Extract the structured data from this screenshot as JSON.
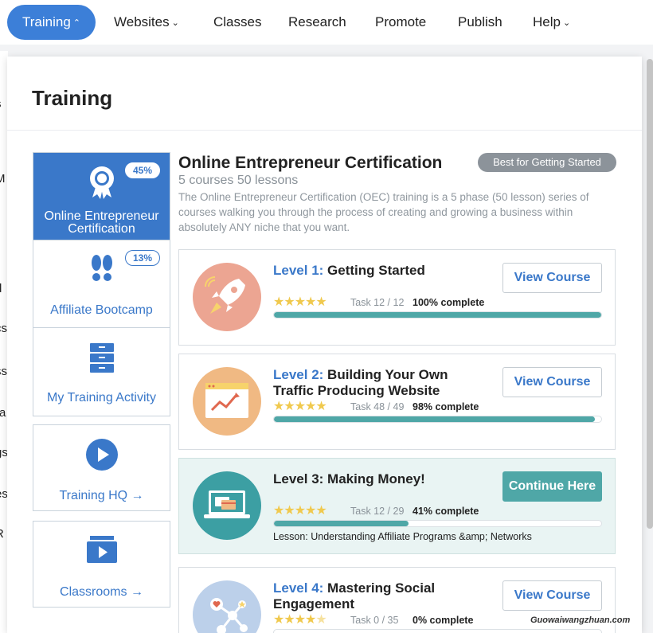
{
  "nav": {
    "items": [
      {
        "label": "Training",
        "caret": "^"
      },
      {
        "label": "Websites",
        "caret": "v"
      },
      {
        "label": "Classes"
      },
      {
        "label": "Research"
      },
      {
        "label": "Promote"
      },
      {
        "label": "Publish"
      },
      {
        "label": "Help",
        "caret": "v"
      }
    ]
  },
  "behind_fragments": [
    "s",
    "M",
    "d",
    "cs",
    "ss",
    "ra",
    "gs",
    "es",
    "R"
  ],
  "panel": {
    "title": "Training"
  },
  "sidebar": {
    "items": [
      {
        "label": "Online Entrepreneur Certification",
        "percent": "45%",
        "icon": "award-ribbon-icon",
        "active": true
      },
      {
        "label": "Affiliate Bootcamp",
        "percent": "13%",
        "icon": "footprints-icon"
      },
      {
        "label": "My Training Activity",
        "icon": "file-cabinet-icon"
      }
    ],
    "training_hq": {
      "label": "Training HQ",
      "arrow": "→",
      "icon": "play-circle-icon"
    },
    "classrooms": {
      "label": "Classrooms",
      "arrow": "→",
      "icon": "video-player-icon"
    }
  },
  "certification": {
    "title": "Online Entrepreneur Certification",
    "subtitle": "5 courses 50 lessons",
    "description": "The Online Entrepreneur Certification (OEC) training is a 5 phase (50 lesson) series of courses walking you through the process of creating and growing a business within absolutely ANY niche that you want.",
    "badge": "Best for Getting Started"
  },
  "courses": [
    {
      "level": "Level 1:",
      "title": "Getting Started",
      "task": "Task 12 / 12",
      "complete": "100% complete",
      "progress": 1.0,
      "rating": "5 stars",
      "button": "View Course",
      "icon": "rocket-icon",
      "circle_color": "#eca592"
    },
    {
      "level": "Level 2:",
      "title": "Building Your Own Traffic Producing Website",
      "task": "Task 48 / 49",
      "complete": "98% complete",
      "progress": 0.98,
      "rating": "5 stars",
      "button": "View Course",
      "icon": "website-chart-icon",
      "circle_color": "#f0b983"
    },
    {
      "level": "Level 3:",
      "title": "Making Money!",
      "task": "Task 12 / 29",
      "complete": "41% complete",
      "progress": 0.41,
      "rating": "5 stars",
      "button": "Continue Here",
      "lesson": "Lesson: Understanding Affiliate Programs &amp; Networks",
      "icon": "laptop-payment-icon",
      "circle_color": "#3c9fa3",
      "current": true
    },
    {
      "level": "Level 4:",
      "title": "Mastering Social Engagement",
      "task": "Task 0 / 35",
      "complete": "0% complete",
      "progress": 0.0,
      "rating": "4.5 stars",
      "button": "View Course",
      "icon": "social-network-icon",
      "circle_color": "#bcd0ea"
    }
  ],
  "watermark": "Guowaiwangzhuan.com"
}
